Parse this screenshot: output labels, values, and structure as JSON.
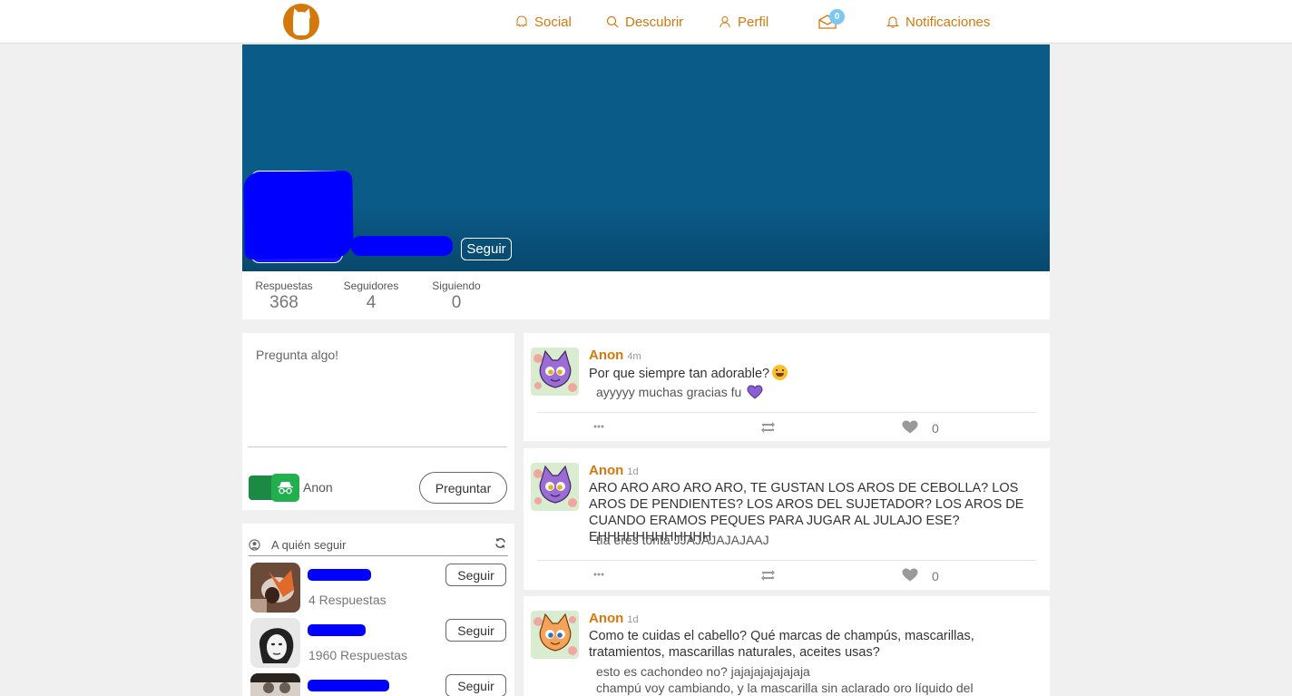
{
  "nav": {
    "social": "Social",
    "discover": "Descubrir",
    "profile": "Perfil",
    "inbox_count": "0",
    "notifications": "Notificaciones"
  },
  "profile": {
    "follow_label": "Seguir",
    "stats": [
      {
        "label": "Respuestas",
        "value": "368"
      },
      {
        "label": "Seguidores",
        "value": "4"
      },
      {
        "label": "Siguiendo",
        "value": "0"
      }
    ]
  },
  "ask": {
    "placeholder": "Pregunta algo!",
    "anon_label": "Anon",
    "submit_label": "Preguntar"
  },
  "who_to_follow": {
    "title": "A quién seguir",
    "items": [
      {
        "count": "4 Respuestas",
        "follow": "Seguir"
      },
      {
        "count": "1960 Respuestas",
        "follow": "Seguir"
      },
      {
        "count": "",
        "follow": "Seguir"
      }
    ]
  },
  "feed": [
    {
      "author": "Anon",
      "time": "4m",
      "question": "Por que siempre tan adorable?",
      "answer": "ayyyyy muchas gracias fu",
      "likes": "0"
    },
    {
      "author": "Anon",
      "time": "1d",
      "question": "ARO ARO ARO ARO ARO, TE GUSTAN LOS AROS DE CEBOLLA? LOS AROS DE PENDIENTES? LOS AROS DEL SUJETADOR? LOS AROS DE CUANDO ERAMOS PEQUES PARA JUGAR AL JULAJO ESE? EHHHHHHHHHHHH",
      "answer": "tía eres tonta JJAJAJAJAJAAJ",
      "likes": "0"
    },
    {
      "author": "Anon",
      "time": "1d",
      "question": "Como te cuidas el cabello? Qué marcas de champús, mascarillas, tratamientos, mascarillas naturales, aceites usas?",
      "answer": "esto es cachondeo no? jajajajajajajaja",
      "answer2": "champú voy cambiando, y la mascarilla sin aclarado oro líquido del",
      "likes": "0"
    }
  ]
}
